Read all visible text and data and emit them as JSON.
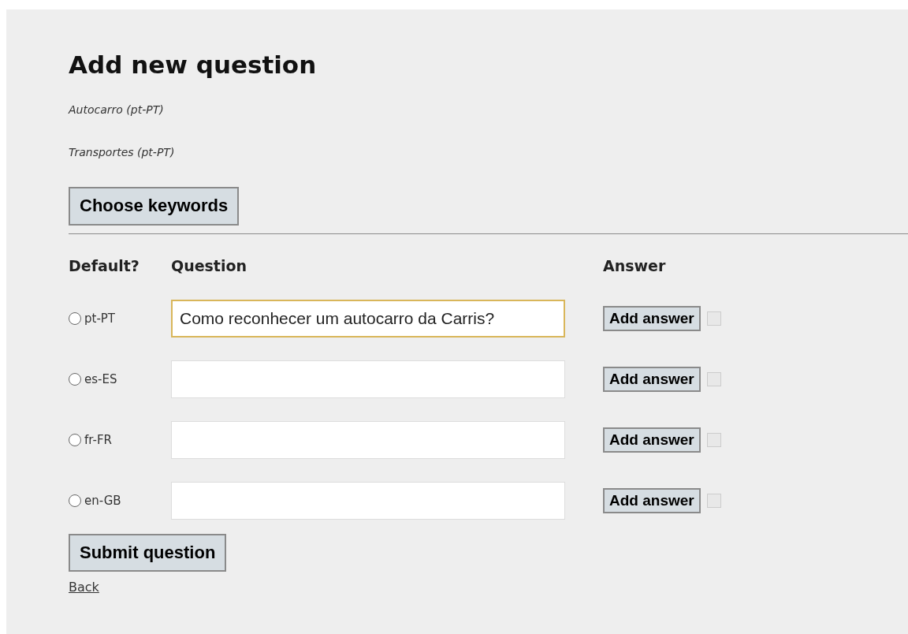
{
  "title": "Add new question",
  "subtitles": [
    "Autocarro (pt-PT)",
    "Transportes (pt-PT)"
  ],
  "keywords_button": "Choose keywords",
  "columns": [
    "Default?",
    "Question",
    "Answer"
  ],
  "rows": [
    {
      "language": "pt-PT",
      "selected": false,
      "question": "Como reconhecer um autocarro da Carris?",
      "focused": true,
      "answer_button": "Add answer",
      "checked": false,
      "disabled": true
    },
    {
      "language": "es-ES",
      "selected": false,
      "question": "",
      "focused": false,
      "answer_button": "Add answer",
      "checked": false,
      "disabled": true
    },
    {
      "language": "fr-FR",
      "selected": false,
      "question": "",
      "focused": false,
      "answer_button": "Add answer",
      "checked": false,
      "disabled": true
    },
    {
      "language": "en-GB",
      "selected": false,
      "question": "",
      "focused": false,
      "answer_button": "Add answer",
      "checked": false,
      "disabled": true
    }
  ],
  "submit_button": "Submit question",
  "back_link": "Back"
}
